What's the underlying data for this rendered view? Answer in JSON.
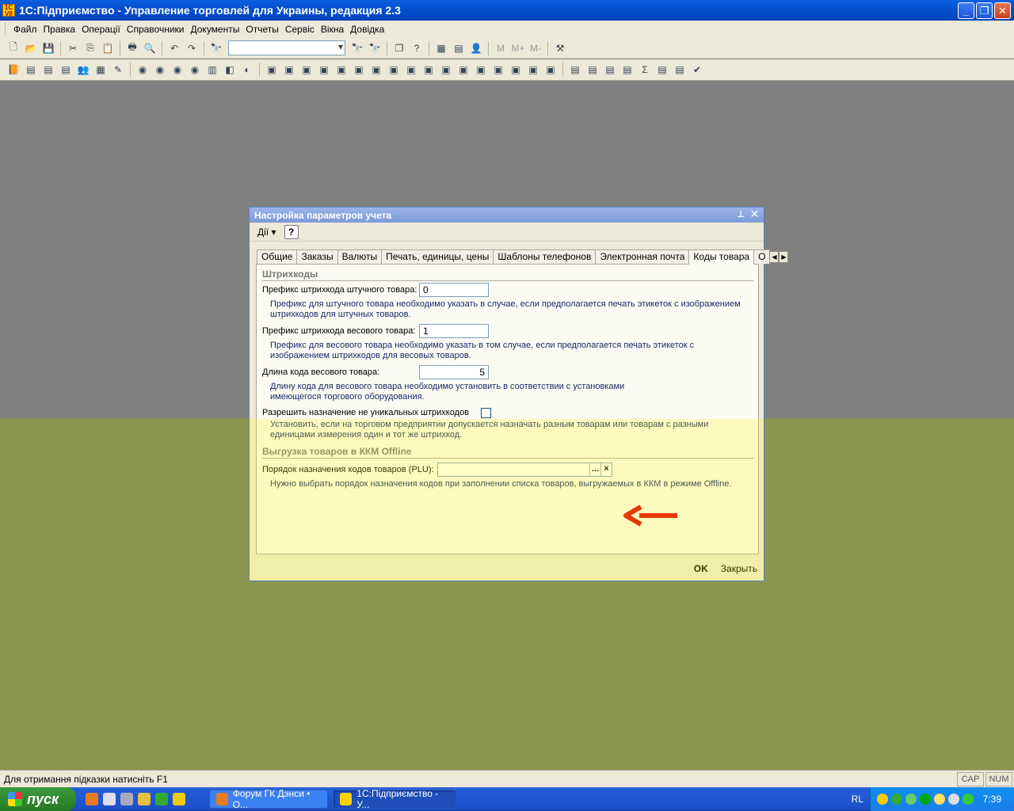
{
  "window": {
    "title": "1С:Підприємство - Управление торговлей для Украины, редакция 2.3"
  },
  "menu": [
    "Файл",
    "Правка",
    "Операції",
    "Справочники",
    "Документы",
    "Отчеты",
    "Сервіс",
    "Вікна",
    "Довідка"
  ],
  "toolbar": {
    "m": "M",
    "mplus": "M+",
    "mminus": "M-"
  },
  "dialog": {
    "title": "Настройка параметров учета",
    "actions_label": "Дії",
    "help_label": "?",
    "tabs": [
      "Общие",
      "Заказы",
      "Валюты",
      "Печать, единицы, цены",
      "Шаблоны телефонов",
      "Электронная почта",
      "Коды товара",
      "О"
    ],
    "active_tab": "Коды товара",
    "section_barcodes": "Штрихкоды",
    "piece_prefix_label": "Префикс штрихкода штучного товара:",
    "piece_prefix_value": "0",
    "piece_prefix_hint": "Префикс для штучного товара необходимо указать в случае, если предполагается печать этикеток с изображением штрихкодов для штучных товаров.",
    "weight_prefix_label": "Префикс штрихкода весового товара:",
    "weight_prefix_value": "1",
    "weight_prefix_hint": "Префикс для весового товара необходимо указать в том случае, если предполагается печать этикеток с изображением штрихкодов для весовых товаров.",
    "weight_code_len_label": "Длина кода весового товара:",
    "weight_code_len_value": "5",
    "weight_code_len_hint": "Длину кода для весового товара необходимо установить в соответствии с установками имеющегося торгового оборудования.",
    "allow_nonunique_label": "Разрешить назначение не уникальных штрихкодов",
    "allow_nonunique_hint": "Установить, если на торговом предприятии допускается назначать разным товарам или товарам с разными единицами измерения один и тот же штрихкод.",
    "section_kkm": "Выгрузка товаров в ККМ Offline",
    "plu_label": "Порядок назначения кодов товаров (PLU):",
    "plu_select": "...",
    "plu_clear": "×",
    "plu_hint": "Нужно выбрать порядок назначения кодов при заполнении списка товаров, выгружаемых в ККМ в режиме Offline.",
    "ok_label": "OK",
    "close_label": "Закрыть"
  },
  "status": {
    "message": "Для отримання підказки натисніть F1",
    "cap": "CAP",
    "num": "NUM"
  },
  "taskbar": {
    "start": "пуск",
    "tasks": [
      "Форум ГК Дэнси • О...",
      "1С:Підприємство - У..."
    ],
    "lang": "RL",
    "clock": "7:39"
  },
  "colors": {
    "titlebar": "#0450d0",
    "arrow": "#e00000",
    "desktop": "#808080",
    "overlay": "#8a9550"
  }
}
